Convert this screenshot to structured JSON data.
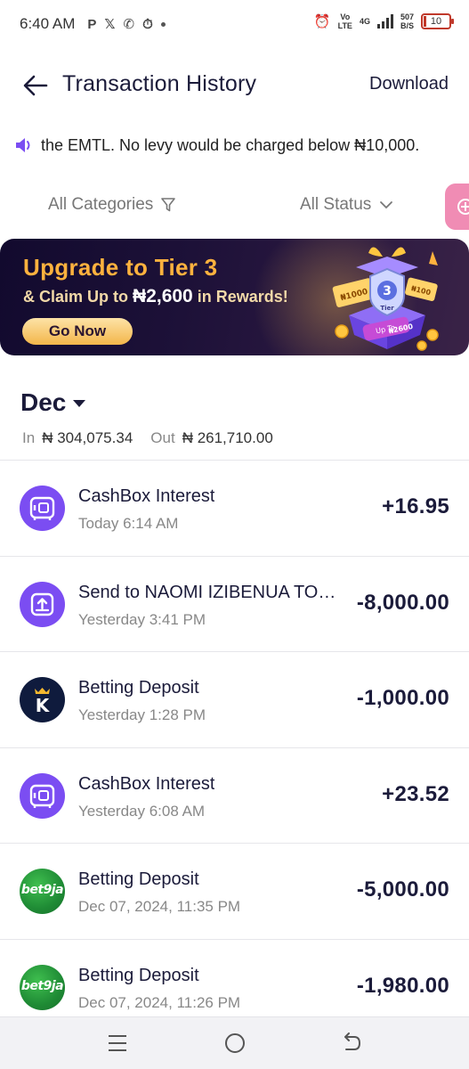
{
  "status_bar": {
    "time": "6:40 AM",
    "network_label_top": "Vo",
    "network_label_bottom": "LTE",
    "network_type": "4G",
    "speed_value": "507",
    "speed_unit": "B/S",
    "battery": "10"
  },
  "header": {
    "title": "Transaction History",
    "download_label": "Download"
  },
  "ticker": {
    "text": "the EMTL. No levy would be charged below ₦10,000."
  },
  "filters": {
    "categories_label": "All Categories",
    "status_label": "All Status"
  },
  "banner": {
    "title": "Upgrade to Tier 3",
    "subtitle_prefix": "& Claim Up to ",
    "subtitle_amount": "₦2,600",
    "subtitle_suffix": " in Rewards!",
    "button_label": "Go Now",
    "tier_number": "3",
    "tier_label": "Tier",
    "ticket_left": "₦1000",
    "ticket_right": "₦100",
    "gift_up_to": "Up To",
    "gift_amount": "₦2600"
  },
  "summary": {
    "month": "Dec",
    "in_label": "In",
    "in_value": "₦ 304,075.34",
    "out_label": "Out",
    "out_value": "₦ 261,710.00"
  },
  "transactions": [
    {
      "name": "CashBox Interest",
      "time": "Today 6:14 AM",
      "amount": "+16.95",
      "icon": "cashbox-icon"
    },
    {
      "name": "Send to NAOMI IZIBENUA TOKORIKOKO",
      "time": "Yesterday 3:41 PM",
      "amount": "-8,000.00",
      "icon": "send-upload-icon"
    },
    {
      "name": "Betting Deposit",
      "time": "Yesterday 1:28 PM",
      "amount": "-1,000.00",
      "icon": "kingmakers-k-icon",
      "logo_text": "K"
    },
    {
      "name": "CashBox Interest",
      "time": "Yesterday 6:08 AM",
      "amount": "+23.52",
      "icon": "cashbox-icon"
    },
    {
      "name": "Betting Deposit",
      "time": "Dec 07, 2024, 11:35 PM",
      "amount": "-5,000.00",
      "icon": "bet9ja-logo-icon",
      "logo_text": "bet9ja"
    },
    {
      "name": "Betting Deposit",
      "time": "Dec 07, 2024, 11:26 PM",
      "amount": "-1,980.00",
      "icon": "bet9ja-logo-icon",
      "logo_text": "bet9ja"
    }
  ],
  "colors": {
    "accent_purple": "#7b4df2",
    "banner_gold": "#ffb23e",
    "fab_pink": "#f08cb4",
    "bet9ja_green": "#1f8b35"
  }
}
